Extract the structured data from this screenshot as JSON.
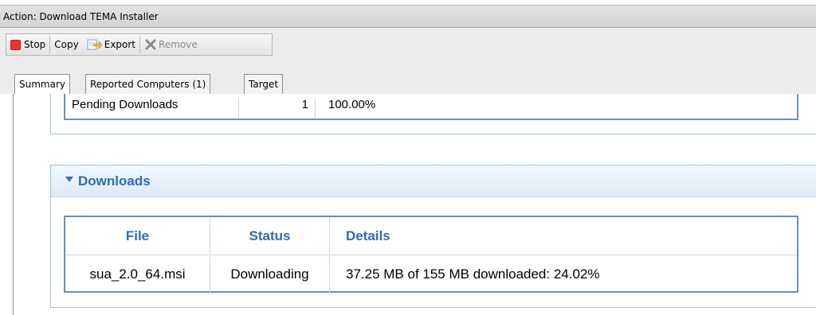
{
  "window": {
    "title": "Action: Download TEMA Installer"
  },
  "toolbar": {
    "stop_label": "Stop",
    "copy_label": "Copy",
    "export_label": "Export",
    "remove_label": "Remove"
  },
  "tabs": [
    {
      "label": "Summary",
      "active": true
    },
    {
      "label": "Reported Computers (1)",
      "active": false
    },
    {
      "label": "Target",
      "active": false
    }
  ],
  "pending": {
    "label": "Pending Downloads",
    "count": "1",
    "percent": "100.00%"
  },
  "downloads": {
    "section_title": "Downloads",
    "columns": [
      "File",
      "Status",
      "Details"
    ],
    "rows": [
      {
        "file": "sua_2.0_64.msi",
        "status": "Downloading",
        "details": "37.25 MB of 155 MB downloaded: 24.02%"
      }
    ]
  },
  "colors": {
    "accent": "#2e6cae",
    "stop": "#e8333b",
    "border": "#6b8fb8"
  },
  "icons": {
    "stop": "stop-icon",
    "export": "export-icon",
    "remove": "remove-icon",
    "collapse": "chevron-down-icon"
  }
}
